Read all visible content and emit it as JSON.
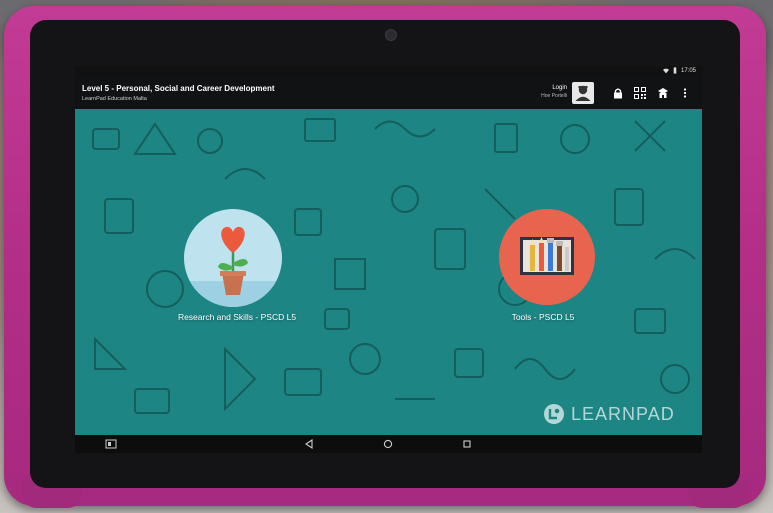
{
  "status_bar": {
    "time": "17:05"
  },
  "app_bar": {
    "title": "Level 5 - Personal, Social and Career Development",
    "subtitle": "LearnPad Education Malta",
    "login_label": "Login",
    "login_user": "Hoe Portelli",
    "icons": [
      "avatar-icon",
      "lock-icon",
      "qr-code-icon",
      "school-icon",
      "more-vert-icon"
    ]
  },
  "apps": [
    {
      "label": "Research and Skills - PSCD L5",
      "icon": "flower-pot-icon",
      "circle_color": "#bfe2ef"
    },
    {
      "label": "Tools - PSCD L5",
      "icon": "paint-tools-icon",
      "circle_color": "#e9644f"
    }
  ],
  "watermark": {
    "brand": "LEARNPAD"
  },
  "nav_bar": {
    "buttons": [
      "screenshot-icon",
      "back-icon",
      "home-icon",
      "recents-icon"
    ]
  },
  "colors": {
    "case": "#b22f87",
    "wallpaper": "#1d8583",
    "doodles": "#145e5d"
  }
}
